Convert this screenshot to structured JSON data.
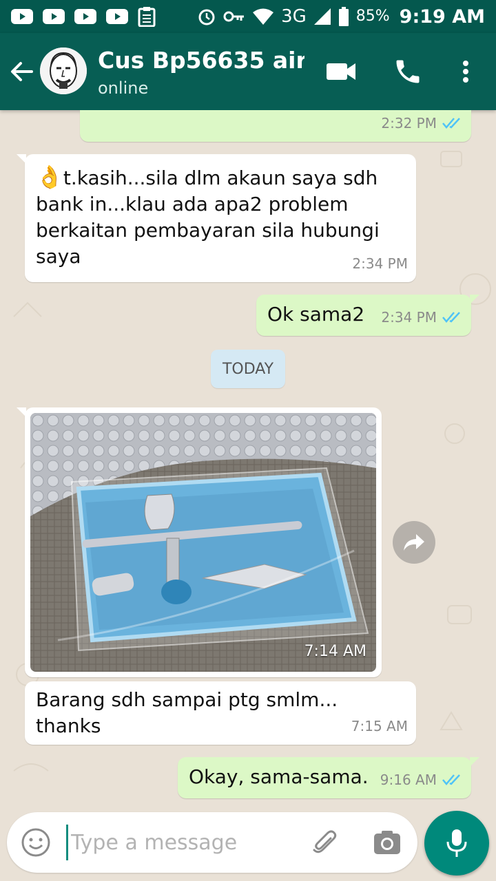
{
  "status_bar": {
    "network": "3G",
    "battery": "85%",
    "time": "9:19 AM",
    "icons": [
      "youtube-icon",
      "youtube-icon",
      "youtube-icon",
      "youtube-icon",
      "clipboard-icon",
      "alarm-icon",
      "key-icon",
      "wifi-icon",
      "signal-icon",
      "battery-icon"
    ]
  },
  "header": {
    "contact_name": "Cus Bp56635 air...",
    "status": "online",
    "back_icon": "arrow-left-icon",
    "actions": [
      "video-call-icon",
      "phone-icon",
      "more-vert-icon"
    ]
  },
  "messages": [
    {
      "direction": "out",
      "text": "",
      "time": "2:32 PM",
      "status": "read"
    },
    {
      "direction": "in",
      "emoji": "👌",
      "text": "t.kasih...sila dlm akaun saya sdh bank in...klau ada apa2 problem berkaitan pembayaran sila hubungi saya",
      "time": "2:34 PM"
    },
    {
      "direction": "out",
      "text": "Ok sama2",
      "time": "2:34 PM",
      "status": "read"
    },
    {
      "type": "date",
      "text": "TODAY"
    },
    {
      "direction": "in",
      "type": "image",
      "caption": "",
      "time": "7:14 AM"
    },
    {
      "direction": "in",
      "text": "Barang sdh sampai ptg smlm... thanks",
      "time": "7:15 AM"
    },
    {
      "direction": "out",
      "text": "Okay, sama-sama.",
      "time": "9:16 AM",
      "status": "read"
    }
  ],
  "composer": {
    "placeholder": "Type a message",
    "value": "",
    "icons": [
      "emoji-icon",
      "attach-icon",
      "camera-icon",
      "mic-icon"
    ]
  },
  "colors": {
    "status_bar": "#04584e",
    "app_bar": "#075e54",
    "outgoing_bubble": "#dcf8c6",
    "incoming_bubble": "#ffffff",
    "chat_background": "#e9e1d6",
    "read_ticks": "#4fc3f7",
    "mic_button": "#00897b"
  }
}
